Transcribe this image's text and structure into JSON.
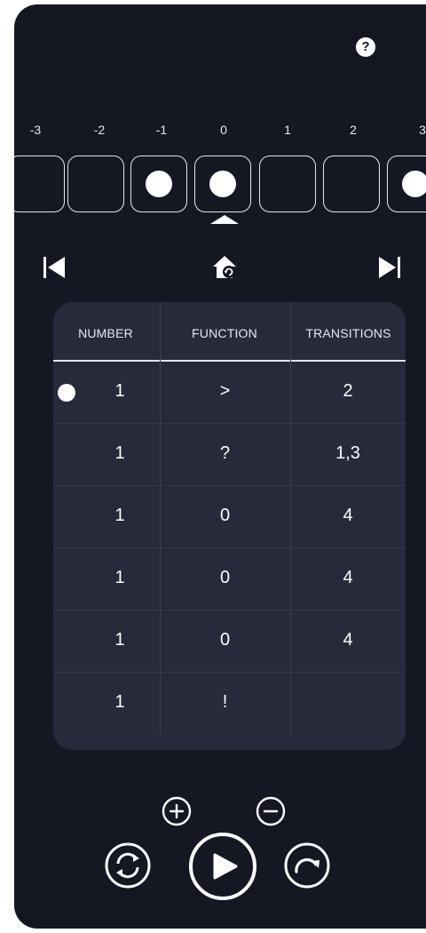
{
  "help": {
    "label": "?"
  },
  "tape": {
    "indices": [
      "-3",
      "-2",
      "-1",
      "0",
      "1",
      "2",
      "3"
    ],
    "cells": [
      {
        "filled": false
      },
      {
        "filled": false
      },
      {
        "filled": true
      },
      {
        "filled": true
      },
      {
        "filled": false
      },
      {
        "filled": false
      },
      {
        "filled": true
      }
    ],
    "head_index": "0"
  },
  "table": {
    "headers": {
      "number": "NUMBER",
      "function": "FUNCTION",
      "transitions": "TRANSITIONS"
    },
    "active_row": 0,
    "rows": [
      {
        "number": "1",
        "function": ">",
        "transitions": "2"
      },
      {
        "number": "1",
        "function": "?",
        "transitions": "1,3"
      },
      {
        "number": "1",
        "function": "0",
        "transitions": "4"
      },
      {
        "number": "1",
        "function": "0",
        "transitions": "4"
      },
      {
        "number": "1",
        "function": "0",
        "transitions": "4"
      },
      {
        "number": "1",
        "function": "!",
        "transitions": ""
      }
    ]
  },
  "colors": {
    "background": "#151823",
    "card": "#262a3b",
    "foreground": "#ffffff"
  },
  "icons": {
    "help": "question-circle-icon",
    "skip_back": "skip-to-start-icon",
    "home": "home-reset-icon",
    "skip_forward": "skip-to-end-icon",
    "zoom_in": "plus-circle-icon",
    "zoom_out": "minus-circle-icon",
    "reset": "sync-icon",
    "play": "play-icon",
    "step": "redo-icon"
  }
}
